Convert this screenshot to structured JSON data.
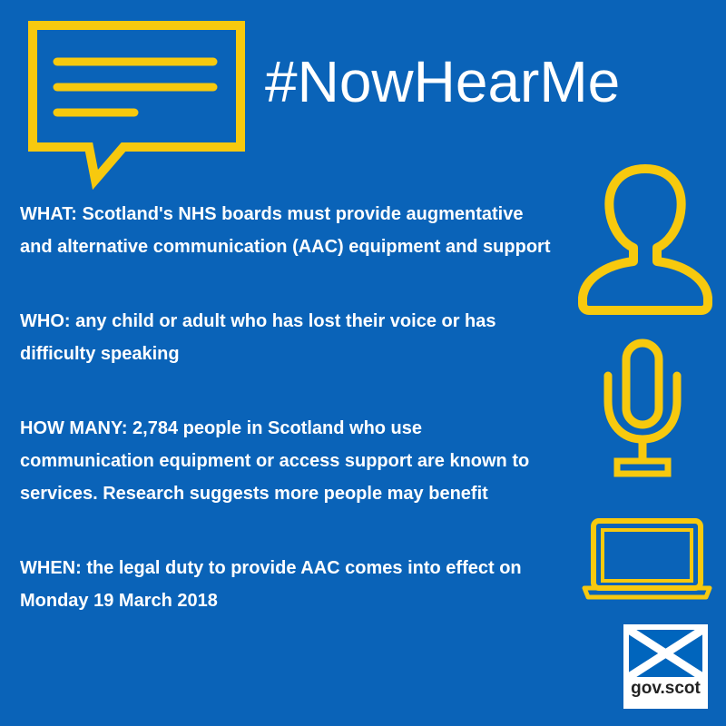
{
  "title": "#NowHearMe",
  "sections": [
    {
      "text": "WHAT: Scotland's NHS boards must provide augmentative and alternative communication (AAC) equipment and support"
    },
    {
      "text": "WHO: any child or adult who has lost their voice or has difficulty speaking"
    },
    {
      "text": "HOW MANY: 2,784 people in Scotland who use communication equipment or access support are known to services. Research suggests more people may benefit"
    },
    {
      "text": "WHEN: the legal duty to provide AAC comes into effect on Monday 19 March 2018"
    }
  ],
  "logo": {
    "text": "gov.scot"
  },
  "icons": [
    "speech-bubble-icon",
    "person-icon",
    "microphone-icon",
    "laptop-icon",
    "saltire-flag-icon"
  ],
  "colors": {
    "background": "#0a63b8",
    "accent": "#f7c90e",
    "text": "#ffffff"
  }
}
